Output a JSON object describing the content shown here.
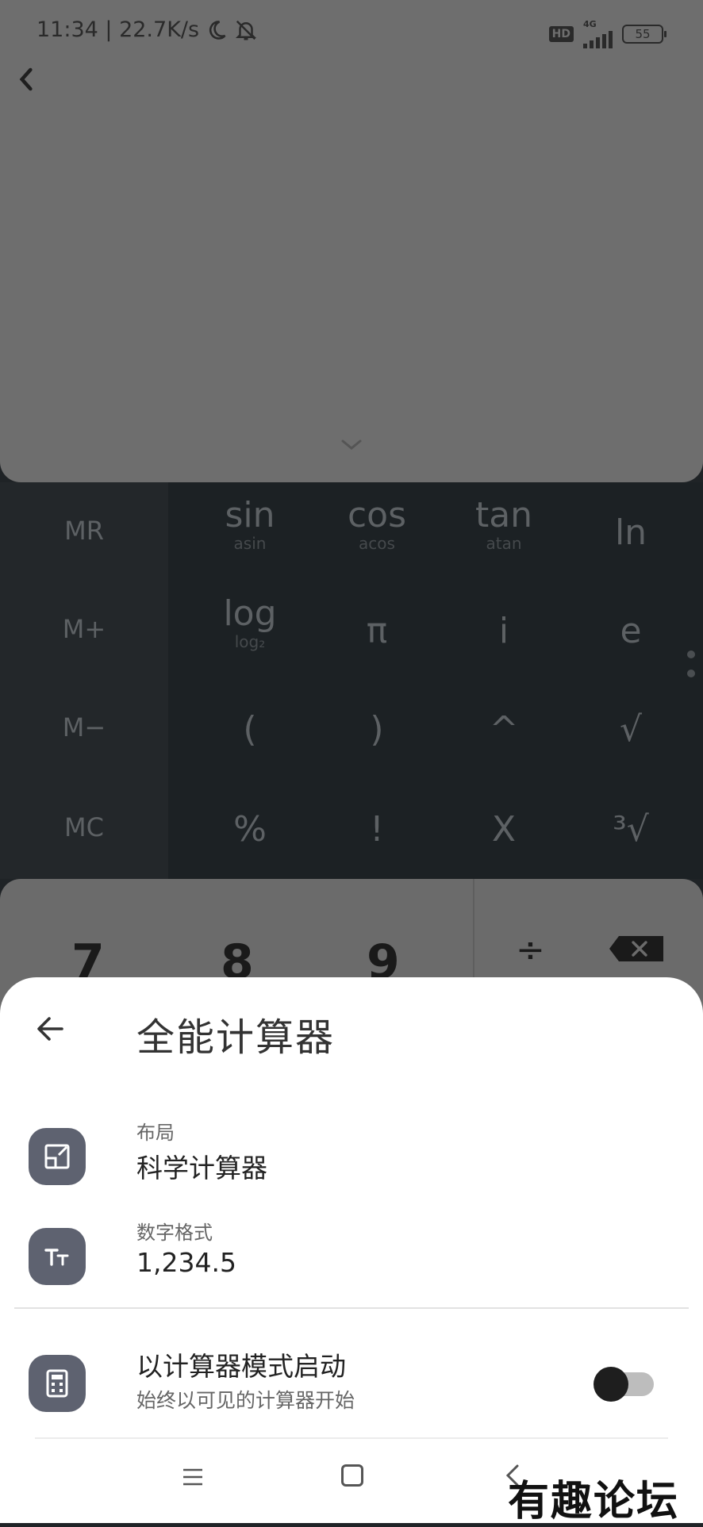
{
  "status_bar": {
    "time_speed": "11:34 | 22.7K/s",
    "hd": "HD",
    "network": "4G",
    "battery": "55"
  },
  "scientific": {
    "memory": [
      "MR",
      "M+",
      "M−",
      "MC"
    ],
    "rows": [
      [
        {
          "main": "sin",
          "sub": "asin"
        },
        {
          "main": "cos",
          "sub": "acos"
        },
        {
          "main": "tan",
          "sub": "atan"
        },
        {
          "main": "ln",
          "sub": ""
        }
      ],
      [
        {
          "main": "log",
          "sub": "log₂"
        },
        {
          "main": "π",
          "sub": ""
        },
        {
          "main": "i",
          "sub": ""
        },
        {
          "main": "e",
          "sub": ""
        }
      ],
      [
        {
          "main": "(",
          "sub": ""
        },
        {
          "main": ")",
          "sub": ""
        },
        {
          "main": "^",
          "sub": ""
        },
        {
          "main": "√",
          "sub": ""
        }
      ],
      [
        {
          "main": "%",
          "sub": ""
        },
        {
          "main": "!",
          "sub": ""
        },
        {
          "main": "X",
          "sub": ""
        },
        {
          "main": "³√",
          "sub": ""
        }
      ]
    ]
  },
  "number_pad": {
    "keys": [
      "7",
      "8",
      "9"
    ],
    "divide": "÷"
  },
  "sheet": {
    "title": "全能计算器",
    "layout_label": "布局",
    "layout_value": "科学计算器",
    "format_label": "数字格式",
    "format_value": "1,234.5",
    "start_label": "以计算器模式启动",
    "start_sub": "始终以可见的计算器开始",
    "start_enabled": false
  },
  "watermark": "有趣论坛",
  "icons": {
    "top_back": "chevron-left-icon",
    "collapse": "chevron-down-icon",
    "layout": "layout-icon",
    "format": "text-size-icon",
    "calculator": "calculator-icon",
    "backspace": "backspace-icon"
  }
}
